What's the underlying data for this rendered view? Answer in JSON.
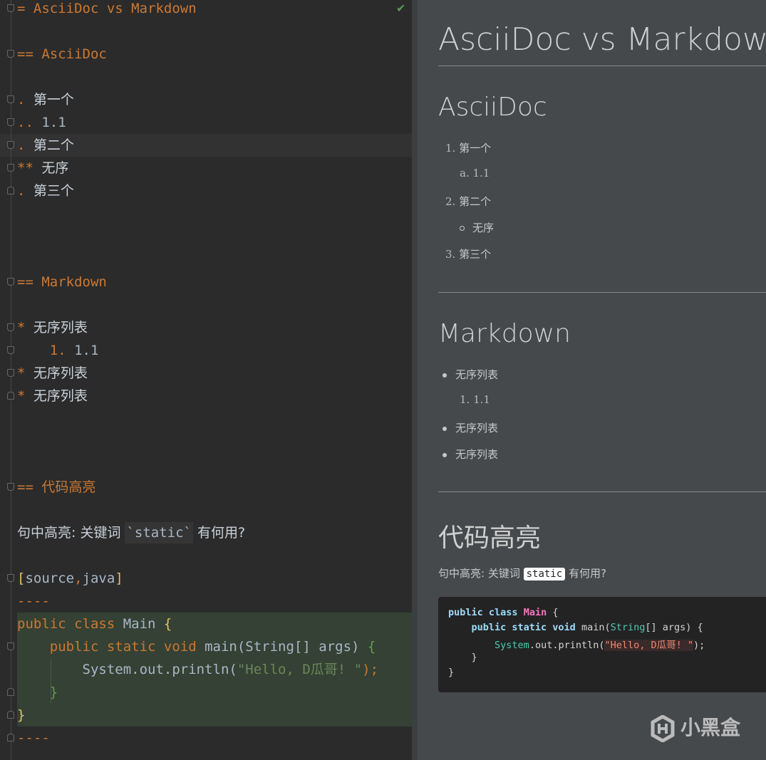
{
  "editor": {
    "line1": "= AsciiDoc vs Markdown",
    "line2": "== AsciiDoc",
    "l3_marker": ".",
    "l3_text": "第一个",
    "l4_marker": "..",
    "l4_text": "1.1",
    "l5_marker": ".",
    "l5_text": "第二个",
    "l6_marker": "**",
    "l6_text": "无序",
    "l7_marker": ".",
    "l7_text": "第三个",
    "line8": "== Markdown",
    "l9_marker": "*",
    "l9_text": "无序列表",
    "l10_marker": "1.",
    "l10_text": "1.1",
    "l11_marker": "*",
    "l11_text": "无序列表",
    "l12_marker": "*",
    "l12_text": "无序列表",
    "line13": "== 代码高亮",
    "l14_pre": "句中高亮: 关键词 ",
    "l14_code": "`static`",
    "l14_post": " 有何用?",
    "l15_open": "[",
    "l15_a": "source",
    "l15_comma": ",",
    "l15_b": "java",
    "l15_close": "]",
    "delim": "----",
    "c1_kw": "public class",
    "c1_name": " Main ",
    "c1_brace": "{",
    "c2_kw": "public static void",
    "c2_rest": " main(String[] args) ",
    "c2_brace": "{",
    "c3_pre": "System.out.println(",
    "c3_str": "\"Hello, D瓜哥! \"",
    "c3_post": ");",
    "c4_brace": "}",
    "c5_brace": "}"
  },
  "preview": {
    "title": "AsciiDoc vs Markdown",
    "h_asciidoc": "AsciiDoc",
    "a_items": [
      {
        "num": "1.",
        "text": "第一个"
      },
      {
        "num": "a.",
        "text": "1.1"
      },
      {
        "num": "2.",
        "text": "第二个"
      },
      {
        "num": "",
        "text": "无序"
      },
      {
        "num": "3.",
        "text": "第三个"
      }
    ],
    "h_markdown": "Markdown",
    "m_items": [
      {
        "num": "",
        "text": "无序列表"
      },
      {
        "num": "1.",
        "text": "1.1"
      },
      {
        "num": "",
        "text": "无序列表"
      },
      {
        "num": "",
        "text": "无序列表"
      }
    ],
    "h_code": "代码高亮",
    "para_pre": "句中高亮: 关键词 ",
    "para_code": "static",
    "para_post": " 有何用?",
    "code": {
      "l1_kw": "public class",
      "l1_name": "Main",
      "l1_rest": " {",
      "l2_kw": "public static void",
      "l2_a": " main(",
      "l2_type": "String",
      "l2_b": "[] args) {",
      "l3_a": "System",
      "l3_b": ".out.println(",
      "l3_str": "\"Hello, D瓜哥! \"",
      "l3_c": ");",
      "l4": "}",
      "l5": "}"
    },
    "watermark": "小黑盒"
  }
}
